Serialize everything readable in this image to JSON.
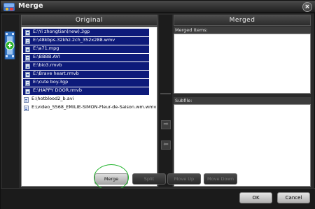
{
  "window": {
    "title": "Merge",
    "close_glyph": "×",
    "app_icon": "app-logo-icon"
  },
  "left_strip": {
    "icon": "film-add-icon"
  },
  "original": {
    "header": "Original",
    "files": [
      {
        "name": "E:\\Yi zhongtian(new).3gp",
        "selected": true
      },
      {
        "name": "E:\\48kbps.32khz.2ch_352x288.wmv",
        "selected": true
      },
      {
        "name": "E:\\a71.mpg",
        "selected": true
      },
      {
        "name": "E:\\BBBB.AVI",
        "selected": true
      },
      {
        "name": "E:\\bio3.rmvb",
        "selected": true
      },
      {
        "name": "E:\\Brave heart.rmvb",
        "selected": true
      },
      {
        "name": "E:\\cute boy.3gp",
        "selected": true
      },
      {
        "name": "E:\\HAPPY DOOR.rmvb",
        "selected": true
      },
      {
        "name": "E:\\hotblood2_b.avi",
        "selected": false
      },
      {
        "name": "E:\\video_5568_EMILIE-SIMON-Fleur-de-Saison.wm.wmv",
        "selected": false
      }
    ]
  },
  "middle": {
    "add_arrow_glyph": "➡",
    "remove_arrow_glyph": "⬅"
  },
  "merged": {
    "header": "Merged",
    "merged_items_label": "Merged Items:",
    "subfile_label": "Subfile:"
  },
  "actions": {
    "merge": "Merge",
    "split": "Split",
    "move_up": "Move Up",
    "move_down": "Move Down"
  },
  "footer": {
    "ok": "OK",
    "cancel": "Cancel"
  },
  "colors": {
    "selection": "#0d1a7a",
    "highlight_ring": "#1fb32a"
  }
}
